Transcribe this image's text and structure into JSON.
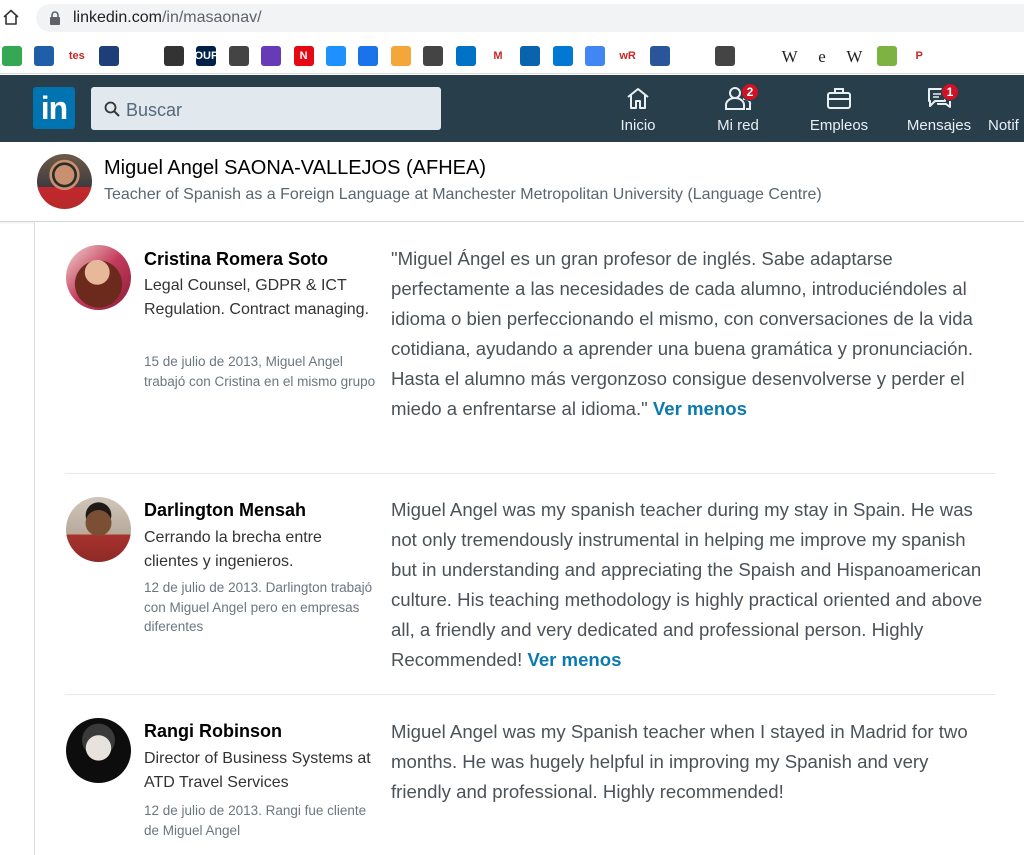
{
  "browser": {
    "url_host": "linkedin.com",
    "url_path": "/in/masaonav/"
  },
  "bookmarks": [
    {
      "name": "maps",
      "label": "",
      "color": "#34a853"
    },
    {
      "name": "dict",
      "label": "",
      "color": "#1f5fa8"
    },
    {
      "name": "tes",
      "label": "tes",
      "color": "#ffffff"
    },
    {
      "name": "ebook",
      "label": "",
      "color": "#1d3e76"
    },
    {
      "name": "red-arrows",
      "label": "",
      "color": "#ffffff"
    },
    {
      "name": "globe",
      "label": "",
      "color": "#333333"
    },
    {
      "name": "oup",
      "label": "OUP",
      "color": "#002147"
    },
    {
      "name": "globe-2",
      "label": "",
      "color": "#444444"
    },
    {
      "name": "list",
      "label": "",
      "color": "#673ab7"
    },
    {
      "name": "netflix",
      "label": "N",
      "color": "#e50914"
    },
    {
      "name": "dropbox",
      "label": "",
      "color": "#1e90ff"
    },
    {
      "name": "diamond",
      "label": "",
      "color": "#1a73e8"
    },
    {
      "name": "ball",
      "label": "",
      "color": "#f4a63a"
    },
    {
      "name": "atom",
      "label": "",
      "color": "#444444"
    },
    {
      "name": "outlook",
      "label": "",
      "color": "#0072c6"
    },
    {
      "name": "gmail",
      "label": "M",
      "color": "#ffffff"
    },
    {
      "name": "outlook-2",
      "label": "",
      "color": "#0a64ad"
    },
    {
      "name": "outlook-3",
      "label": "",
      "color": "#0078d4"
    },
    {
      "name": "translate",
      "label": "",
      "color": "#4285f4"
    },
    {
      "name": "wordreference",
      "label": "wR",
      "color": "#ffffff"
    },
    {
      "name": "docs",
      "label": "",
      "color": "#2a5699"
    },
    {
      "name": "brand",
      "label": "",
      "color": "#ffffff"
    },
    {
      "name": "linguee",
      "label": "",
      "color": "#444444"
    },
    {
      "name": "crest",
      "label": "",
      "color": "#ffffff"
    },
    {
      "name": "wiki-w",
      "label": "W",
      "color": "transparent"
    },
    {
      "name": "wiki-e",
      "label": "e",
      "color": "transparent"
    },
    {
      "name": "wiki-W",
      "label": "W",
      "color": "transparent"
    },
    {
      "name": "frog",
      "label": "",
      "color": "#7cb342"
    },
    {
      "name": "pinterest",
      "label": "P",
      "color": "#ffffff"
    }
  ],
  "nav": {
    "search_placeholder": "Buscar",
    "items": [
      {
        "label": "Inicio",
        "icon": "home-icon",
        "badge": ""
      },
      {
        "label": "Mi red",
        "icon": "network-icon",
        "badge": "2"
      },
      {
        "label": "Empleos",
        "icon": "briefcase-icon",
        "badge": ""
      },
      {
        "label": "Mensajes",
        "icon": "messages-icon",
        "badge": "1"
      },
      {
        "label": "Notif",
        "icon": "notifications-icon",
        "badge": ""
      }
    ]
  },
  "profile": {
    "name": "Miguel Angel SAONA-VALLEJOS (AFHEA)",
    "headline": "Teacher of Spanish as a Foreign Language at Manchester Metropolitan University (Language Centre)"
  },
  "recommendations": [
    {
      "name": "Cristina Romera Soto",
      "headline": "Legal Counsel, GDPR & ICT Regulation. Contract managing.",
      "meta": "15 de julio de 2013, Miguel Angel trabajó con Cristina en el mismo grupo",
      "text": "\"Miguel Ángel es un gran profesor de inglés. Sabe adaptarse perfectamente a las necesidades de cada alumno, introduciéndoles al idioma o bien perfeccionando el mismo, con conversaciones de la vida cotidiana, ayudando a aprender una buena gramática y pronunciación. Hasta el alumno más vergonzoso consigue desenvolverse y perder el miedo a enfrentarse al idioma.\"",
      "toggle": "Ver menos"
    },
    {
      "name": "Darlington Mensah",
      "headline": "Cerrando la brecha entre clientes y ingenieros.",
      "meta": "12 de julio de 2013. Darlington trabajó con Miguel Angel pero en empresas diferentes",
      "text": "Miguel Angel was my spanish teacher during my stay in Spain. He was not only tremendously instrumental in helping me improve my spanish but in understanding and appreciating the Spaish and Hispanoamerican culture. His teaching methodology is highly practical oriented and above all, a friendly and very dedicated and professional person. Highly Recommended!",
      "toggle": "Ver menos"
    },
    {
      "name": "Rangi Robinson",
      "headline": "Director of Business Systems at ATD Travel Services",
      "meta": "12 de julio de 2013. Rangi fue cliente de Miguel Angel",
      "text": "Miguel Angel was my Spanish teacher when I stayed in Madrid for two months. He was hugely helpful in improving my Spanish and very friendly and professional. Highly recommended!",
      "toggle": ""
    }
  ],
  "colors": {
    "nav_bg": "#283e4a",
    "linkedin_blue": "#0073b1",
    "link": "#0b7ab0",
    "badge": "#d11124"
  }
}
